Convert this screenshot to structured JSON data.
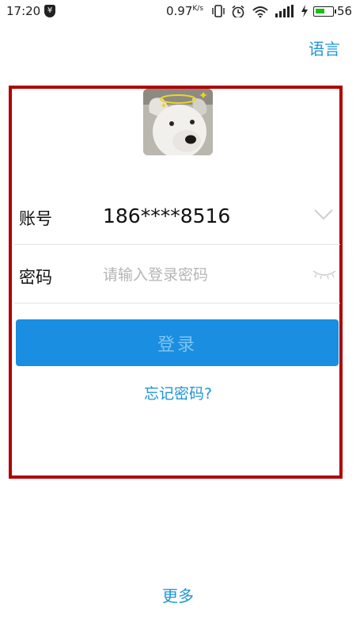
{
  "status_bar": {
    "time": "17:20",
    "net_speed_value": "0.97",
    "net_speed_unit": "K/s",
    "battery_level": "56",
    "battery_fraction": 0.56,
    "icons": [
      "yen-icon",
      "vibrate-icon",
      "alarm-icon",
      "wifi-icon",
      "signal-icon",
      "charging-icon",
      "battery-icon"
    ]
  },
  "header": {
    "language_label": "语言"
  },
  "login_form": {
    "account_label": "账号",
    "account_value": "186****8516",
    "password_label": "密码",
    "password_placeholder": "请输入登录密码",
    "login_button_label": "登录",
    "forgot_password_label": "忘记密码?"
  },
  "footer": {
    "more_label": "更多"
  },
  "colors": {
    "accent": "#2196d6",
    "button": "#1a8ee0",
    "highlight_border": "#b00000"
  }
}
